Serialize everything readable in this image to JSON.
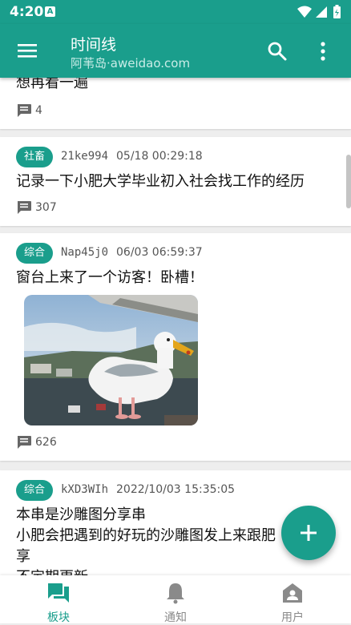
{
  "status_bar": {
    "time": "4:20",
    "notification_letter": "A"
  },
  "app_bar": {
    "title": "时间线",
    "subtitle": "阿苇岛·aweidao.com"
  },
  "posts": [
    {
      "text": "想再看一遍",
      "replies": "4"
    },
    {
      "tag": "社畜",
      "uid": "21ke994",
      "time": "05/18 00:29:18",
      "text": "记录一下小肥大学毕业初入社会找工作的经历",
      "replies": "307"
    },
    {
      "tag": "综合",
      "uid": "Nap45j0",
      "time": "06/03 06:59:37",
      "text": "窗台上来了一个访客！卧槽！",
      "replies": "626",
      "image": "seagull-photo"
    },
    {
      "tag": "综合",
      "uid": "kXD3WIh",
      "time": "2022/10/03 15:35:05",
      "text_lines": [
        "本串是沙雕图分享串",
        "小肥会把遇到的好玩的沙雕图发上来跟肥",
        "享",
        "不定期更新"
      ]
    }
  ],
  "bottom_nav": [
    {
      "label": "板块",
      "icon": "forum-icon",
      "active": true
    },
    {
      "label": "通知",
      "icon": "bell-icon",
      "active": false
    },
    {
      "label": "用户",
      "icon": "home-user-icon",
      "active": false
    }
  ],
  "colors": {
    "primary": "#1a9e8c",
    "background": "#eeeeee",
    "inactive": "#8a8a8a"
  }
}
